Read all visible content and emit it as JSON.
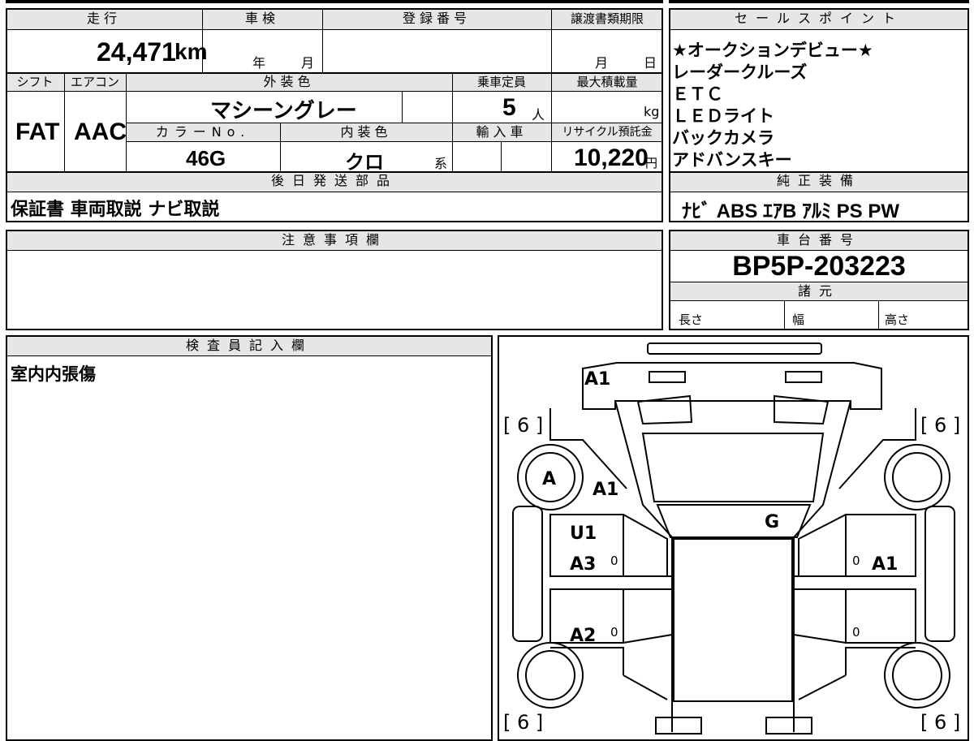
{
  "header": {
    "mileage_label": "走行",
    "shaken_label": "車検",
    "registration_label": "登録番号",
    "transfer_deadline_label": "譲渡書類期限",
    "mileage_value": "24,471",
    "mileage_unit": "km",
    "year_label": "年",
    "month_label": "月",
    "deadline_month": "月",
    "deadline_day": "日"
  },
  "spec": {
    "shift_label": "シフト",
    "aircon_label": "エアコン",
    "exterior_color_label": "外装色",
    "capacity_label": "乗車定員",
    "max_load_label": "最大積載量",
    "shift_value": "FAT",
    "aircon_value": "AAC",
    "exterior_color_value": "マシーングレー",
    "capacity_value": "5",
    "capacity_unit": "人",
    "load_unit": "kg",
    "color_no_label": "カラーNo.",
    "interior_color_label": "内装色",
    "import_label": "輸入車",
    "recycle_label": "リサイクル預託金",
    "color_no_value": "46G",
    "interior_color_value": "クロ",
    "interior_color_suffix": "系",
    "recycle_value": "10,220",
    "recycle_unit": "円"
  },
  "later_parts": {
    "label": "後日発送部品",
    "value": "保証書 車両取説 ナビ取説"
  },
  "sales_points": {
    "label": "セールスポイント",
    "items": [
      "★オークションデビュー★",
      "レーダークルーズ",
      "ＥＴＣ",
      "ＬＥＤライト",
      "バックカメラ",
      "アドバンスキー"
    ]
  },
  "equipment": {
    "label": "純正装備",
    "value": "ﾅﾋﾞ  ABS ｴｱB ｱﾙﾐ PS PW"
  },
  "notes": {
    "label": "注意事項欄"
  },
  "chassis": {
    "label": "車台番号",
    "value": "BP5P-203223",
    "specs_label": "諸元",
    "length_label": "長さ",
    "width_label": "幅",
    "height_label": "高さ"
  },
  "inspector": {
    "label": "検査員記入欄",
    "comment": "室内内張傷"
  },
  "diagram": {
    "tire_fl": "[ 6 ]",
    "tire_fr": "[ 6 ]",
    "tire_rl": "[ 6 ]",
    "tire_rr": "[ 6 ]",
    "code_front": "A1",
    "code_wheel_fl_circle": "A",
    "code_wheel_fl": "A1",
    "code_windshield": "G",
    "code_door_fl_1": "U1",
    "code_door_fl_2": "A3",
    "code_door_rl": "A2",
    "code_door_fr": "A1",
    "handle_mark": "0"
  }
}
